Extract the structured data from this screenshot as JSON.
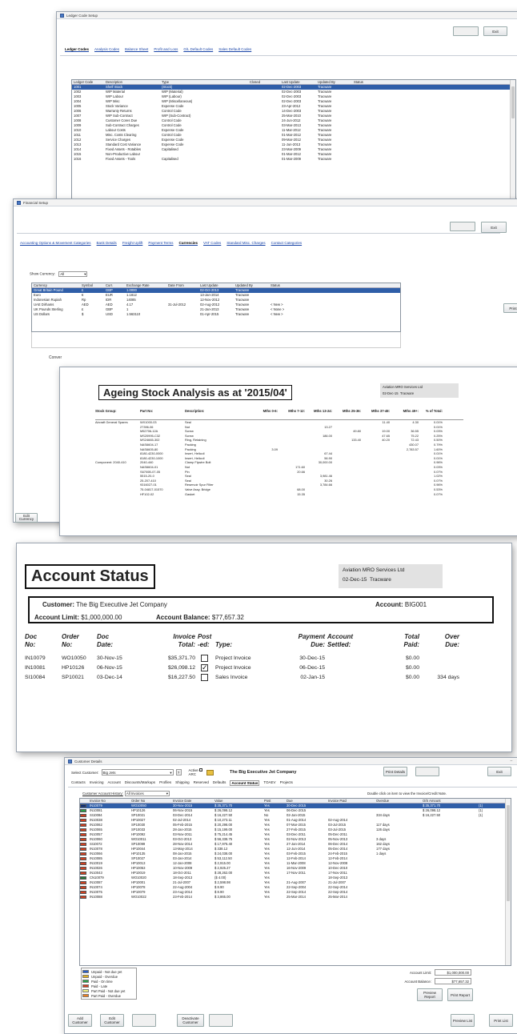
{
  "win1": {
    "title": "Ledger Code Setup",
    "btn_disabled": "",
    "btn_exit": "Exit",
    "tabs": [
      "Ledger Codes",
      "Analysis Codes",
      "Balance Sheet",
      "Profit and Loss",
      "G/L Default Codes",
      "Sales Default Codes"
    ],
    "columns": [
      "Ledger Code",
      "Description",
      "Type",
      "Closed",
      "Last Update",
      "Updated By",
      "Status"
    ],
    "rows": [
      [
        "1001",
        "Shelf Stock",
        "(Stock)",
        "",
        "02-Dec-2003",
        "Tracware",
        ""
      ],
      [
        "1002",
        "WIP Material",
        "WIP (Material)",
        "",
        "02-Dec-2003",
        "Tracware",
        ""
      ],
      [
        "1003",
        "WIP Labour",
        "WIP (Labour)",
        "",
        "02-Dec-2003",
        "Tracware",
        ""
      ],
      [
        "1004",
        "WIP Misc",
        "WIP (Miscellaneous)",
        "",
        "02-Dec-2003",
        "Tracware",
        ""
      ],
      [
        "1005",
        "Stock Variance",
        "Expense Code",
        "",
        "23-Apr-2012",
        "Tracware",
        ""
      ],
      [
        "1006",
        "Warranty Returns",
        "Control Code",
        "",
        "14-Dec-2003",
        "Tracware",
        ""
      ],
      [
        "1007",
        "WIP Sub-Contract",
        "WIP (Sub-Contract)",
        "",
        "25-Mar-2010",
        "Tracware",
        ""
      ],
      [
        "1008",
        "Customer Cores Due",
        "Control Code",
        "",
        "24-Jun-2012",
        "Tracware",
        ""
      ],
      [
        "1009",
        "Sub-Contract Charges",
        "Control Code",
        "",
        "03-Mar-2013",
        "Tracware",
        ""
      ],
      [
        "1010",
        "Labour Costs",
        "Expense Code",
        "",
        "11-Mar-2012",
        "Tracware",
        ""
      ],
      [
        "1011",
        "Misc. Costs Clearing",
        "Control Code",
        "",
        "01-Mar-2012",
        "Tracware",
        ""
      ],
      [
        "1012",
        "Service Charges",
        "Expense Code",
        "",
        "09-Mar-2012",
        "Tracware",
        ""
      ],
      [
        "1013",
        "Standard Cost Variance",
        "Expense Code",
        "",
        "11-Jun-2013",
        "Tracware",
        ""
      ],
      [
        "1014",
        "Fixed Assets - Rotables",
        "Capitalised",
        "",
        "23-Mar-2009",
        "Tracware",
        ""
      ],
      [
        "1015",
        "Non-Productive Labour",
        "",
        "",
        "01-Mar-2012",
        "Tracware",
        ""
      ],
      [
        "1016",
        "Fixed Assets - Tools",
        "Capitalised",
        "",
        "01-Mar-2009",
        "Tracware",
        ""
      ]
    ]
  },
  "win2": {
    "title": "Financial Setup",
    "btn_disabled": "",
    "btn_exit": "Exit",
    "tabs": [
      "Accounting Options & Movement Categories",
      "Bank Details",
      "Freight Uplift",
      "Payment Terms",
      "Currencies",
      "VAT Codes",
      "Standard Misc. Charges",
      "Contact Categories"
    ],
    "show_label": "Show Currency:",
    "show_value": "All",
    "columns": [
      "Currency",
      "Symbol",
      "Curr.",
      "Exchange Rate",
      "Date From",
      "Last Update",
      "Updated By",
      "Status"
    ],
    "rows": [
      [
        "Great Britain Pound",
        "£",
        "GBP",
        "1.0000",
        "",
        "02-Oct-2013",
        "Tracware",
        ""
      ],
      [
        "Euro",
        "€",
        "EUR",
        "1.1812",
        "",
        "13-Jan-2014",
        "Tracware",
        ""
      ],
      [
        "Indonesian Rupiah",
        "Rp",
        "IDR",
        "14085",
        "",
        "12-Nov-2012",
        "Tracware",
        ""
      ],
      [
        "UAE Dirhams",
        "AED",
        "AED",
        "4.17",
        "31-Jul-2012",
        "02-Aug-2012",
        "Tracware",
        "< New >"
      ],
      [
        "UK Pounds Sterling",
        "£",
        "GBP",
        "1",
        "",
        "21-Jan-2013",
        "Tracware",
        "< None >"
      ],
      [
        "US Dollars",
        "$",
        "USD",
        "1.563110",
        "",
        "01-Apr-2015",
        "Tracware",
        "< New >"
      ]
    ],
    "side_label": "Conver",
    "left_btn1": "Edit",
    "left_btn2": "Currency",
    "right_btn": "Print"
  },
  "win3": {
    "title": "Ageing Stock Analysis as at '2015/04'",
    "company": "Aviation MRO Services Ltd",
    "date": "02-Dec-15",
    "user": "Tracware",
    "columns": [
      "Stock Group:",
      "Part No:",
      "Description:",
      "Mths 0-6:",
      "Mths 7-12:",
      "Mths 13-24:",
      "Mths 25-36:",
      "Mths 37-48:",
      "Mths 49+:",
      "% of Total:"
    ],
    "rows": [
      [
        "Aircraft General Spares",
        "WX1000-03",
        "Seal",
        "",
        "",
        "",
        "",
        "11.40",
        "4.30",
        "0.01%"
      ],
      [
        "",
        "27396-06",
        "Nut",
        "",
        "",
        "13.27",
        "",
        "",
        "",
        "0.01%"
      ],
      [
        "",
        "M52706-12A",
        "Screw",
        "",
        "",
        "",
        "49.80",
        "19.00",
        "36.55",
        "0.03%"
      ],
      [
        "",
        "MS20995-C32",
        "Screw",
        "",
        "",
        "186.00",
        "",
        "47.65",
        "75.22",
        "0.25%"
      ],
      [
        "",
        "MS24665-302",
        "Ring, Retaining",
        "",
        "",
        "",
        "133.40",
        "40.20",
        "72.43",
        "0.50%"
      ],
      [
        "",
        "NAS6604-17",
        "Packing",
        "",
        "",
        "",
        "",
        "",
        "430.07",
        "0.79%"
      ],
      [
        "",
        "NAS6605-80",
        "Packing",
        "3.09",
        "",
        "",
        "",
        "",
        "2,783.57",
        "1.60%"
      ],
      [
        "",
        "8180-4230-0000",
        "Insert, Helicoil",
        "",
        "",
        "67.44",
        "",
        "",
        "",
        "0.01%"
      ],
      [
        "",
        "8180-4230-1000",
        "Insert, Helicoil",
        "",
        "",
        "56.90",
        "",
        "",
        "",
        "0.01%"
      ],
      [
        "Component: 2040-410",
        "2040-440",
        "Clamp Flywire Bolt",
        "",
        "",
        "30,000.00",
        "",
        "",
        "",
        "0.96%"
      ],
      [
        "",
        "NAS6604-01",
        "Nut",
        "",
        "171.60",
        "",
        "",
        "",
        "",
        "0.03%"
      ],
      [
        "",
        "S6700B-07-05",
        "Pin",
        "",
        "20.66",
        "",
        "",
        "",
        "",
        "0.07%"
      ],
      [
        "",
        "5515-20-0",
        "Seal",
        "",
        "",
        "3,981.46",
        "",
        "",
        "",
        "1.02%"
      ],
      [
        "",
        "25-207-410",
        "Seal",
        "",
        "",
        "30.26",
        "",
        "",
        "",
        "0.07%"
      ],
      [
        "",
        "9316027-01",
        "Reservoir Spur Filter",
        "",
        "",
        "3,784.66",
        "",
        "",
        "",
        "0.96%"
      ],
      [
        "",
        "75-04817-01570",
        "Valve Assy. Bridge",
        "",
        "68.00",
        "",
        "",
        "",
        "",
        "0.53%"
      ],
      [
        "",
        "HF102-02",
        "Gasket",
        "",
        "15.35",
        "",
        "",
        "",
        "",
        "0.07%"
      ]
    ]
  },
  "win4": {
    "title": "Account Status",
    "company": "Aviation MRO Services Ltd",
    "date": "02-Dec-15",
    "user": "Tracware",
    "customer_label": "Customer:",
    "customer": "The Big Executive Jet Company",
    "account_label": "Account:",
    "account": "BIG001",
    "limit_label": "Account Limit:",
    "limit": "$1,000,000.00",
    "balance_label": "Account Balance:",
    "balance": "$77,657.32",
    "h1": [
      "Doc",
      "Order",
      "Doc",
      "Invoice",
      "Post",
      "",
      "Payment",
      "Account",
      "Total",
      "Over"
    ],
    "h2": [
      "No:",
      "No:",
      "Date:",
      "Total:",
      "-ed:",
      "Type:",
      "Due:",
      "Settled:",
      "Paid:",
      "Due:"
    ],
    "rows": [
      {
        "doc": "IN10079",
        "order": "WO10050",
        "date": "30-Nov-15",
        "total": "$35,371.70",
        "posted": false,
        "type": "Project Invoice",
        "due": "30-Dec-15",
        "settled": "",
        "paid": "$0.00",
        "over": ""
      },
      {
        "doc": "IN10081",
        "order": "HP10126",
        "date": "06-Nov-15",
        "total": "$26,098.12",
        "posted": true,
        "type": "Project Invoice",
        "due": "06-Dec-15",
        "settled": "",
        "paid": "$0.00",
        "over": ""
      },
      {
        "doc": "SI10084",
        "order": "SP10021",
        "date": "03-Dec-14",
        "total": "$16,227.50",
        "posted": false,
        "type": "Sales Invoice",
        "due": "02-Jan-15",
        "settled": "",
        "paid": "$0.00",
        "over": "334 days"
      }
    ]
  },
  "win5": {
    "title": "Customer Details",
    "select_label": "Select Customer:",
    "select_value": "Big Jets",
    "active_label": "Active",
    "active2": "ARC",
    "company": "The Big Executive Jet Company",
    "btn_print": "Print Details",
    "btn_disabled": "",
    "btn_exit": "Exit",
    "tabs": [
      "Contacts",
      "Invoicing",
      "Account",
      "Discounts/Markups",
      "Profiles",
      "Shipping",
      "Reserved",
      "Defaults",
      "Account Status",
      "TOAEV",
      "Projects"
    ],
    "history_label": "Customer Account History:",
    "history_value": "All Invoices",
    "hint": "Double click on item to view the Invoice/Credit Note.",
    "columns": [
      "Invoice No",
      "Order No",
      "Invoice Date",
      "Value",
      "Post",
      "Due",
      "Invoice Paid",
      "Overdue",
      "O/S Amount"
    ],
    "rows": [
      [
        "#0a2a7a",
        "IN10079",
        "WO10050",
        "30-Nov-2015",
        "$ 35,371.70",
        "Yes",
        "30-Dec-2015",
        "",
        "",
        "$ 35,371.70",
        "(1)"
      ],
      [
        "#2aa04a",
        "IN10081",
        "HP10126",
        "06-Nov-2015",
        "$ 26,098.12",
        "Yes",
        "06-Dec-2015",
        "",
        "",
        "$ 26,098.12",
        "(1)"
      ],
      [
        "#d04020",
        "SI10084",
        "SP10021",
        "03-Dec-2014",
        "$ 16,227.50",
        "No",
        "02-Jan-2015",
        "",
        "334 days",
        "$ 16,227.50",
        "(1)"
      ],
      [
        "#d04020",
        "IN10038",
        "HP10027",
        "02-Jul-2014",
        "$ 10,273.11",
        "Yes",
        "01-Aug-2014",
        "02-Aug-2014",
        "",
        ""
      ],
      [
        "#d04020",
        "IN10062",
        "SP10030",
        "05-Feb-2015",
        "$ 20,298.00",
        "Yes",
        "07-Mar-2015",
        "03-Jul-2015",
        "117 days",
        ""
      ],
      [
        "#d04020",
        "IN10065",
        "SP10033",
        "28-Jan-2015",
        "$ 15,199.00",
        "Yes",
        "27-Feb-2015",
        "03-Jul-2015",
        "126 days",
        ""
      ],
      [
        "#d04020",
        "IN10057",
        "HP10092",
        "03-Nov-2011",
        "$ 75,214.45",
        "Yes",
        "03-Dec-2011",
        "05-Dec-2011",
        "",
        ""
      ],
      [
        "#d04020",
        "IN10060",
        "WO10011",
        "03-Oct-2013",
        "$ 56,338.75",
        "Yes",
        "02-Nov-2013",
        "05-Nov-2013",
        "3 days",
        ""
      ],
      [
        "#d04020",
        "SI10072",
        "SP10099",
        "28-Nov-2014",
        "$ 17,976.40",
        "Yes",
        "27-Jan-2014",
        "06-Dec-2014",
        "162 days",
        ""
      ],
      [
        "#d04020",
        "IN10078",
        "HP10044",
        "13-May-2014",
        "$ 338.12",
        "Yes",
        "12-Jun-2014",
        "05-Dec-2014",
        "177 days",
        ""
      ],
      [
        "#d04020",
        "IN10066",
        "HP10135",
        "08-Jan-2015",
        "$ 24,038.00",
        "Yes",
        "03-Feb-2015",
        "24-Feb-2015",
        "1 days",
        ""
      ],
      [
        "#d04020",
        "IN10085",
        "SP10027",
        "03-Jan-2014",
        "$ 53,112.50",
        "Yes",
        "12-Feb-2014",
        "12-Feb-2014",
        "",
        ""
      ],
      [
        "#d04020",
        "IN10019",
        "HP10013",
        "12-Jan-2008",
        "$ 2,915.00",
        "Yes",
        "11-Mar-2008",
        "12-Nov-2008",
        "",
        ""
      ],
      [
        "#d04020",
        "IN10026",
        "HP10053",
        "10-Nov-2009",
        "$ 2,925.27",
        "Yes",
        "16-Nov-2009",
        "10-Dec-2010",
        "",
        ""
      ],
      [
        "#d04020",
        "IN10043",
        "HP10019",
        "18-Oct-2011",
        "$ 28,262.00",
        "Yes",
        "17-Nov-2011",
        "17-Nov-2011",
        "",
        ""
      ],
      [
        "#2a7a3a",
        "CN10079",
        "WO10020",
        "18-Sep-2013",
        "($ 4.00)",
        "Yes",
        "",
        "18-Sep-2013",
        "",
        ""
      ],
      [
        "#d04020",
        "IN10087",
        "HP10001",
        "21-Jul-2007",
        "$ 2,598.98",
        "Yes",
        "21-Aug-2007",
        "21-Jul-2007",
        "",
        ""
      ],
      [
        "#d04020",
        "IN10074",
        "HP10078",
        "22-Aug-2004",
        "$ 8.90",
        "Yes",
        "22-Sep-2004",
        "22-Sep-2014",
        "",
        ""
      ],
      [
        "#d04020",
        "IN10075",
        "HP10079",
        "23-Aug-2014",
        "$ 8.90",
        "Yes",
        "22-Sep-2014",
        "22-Sep-2014",
        "",
        ""
      ],
      [
        "#d04020",
        "IN10088",
        "WO10022",
        "23-Feb-2014",
        "$ 3,865.00",
        "Yes",
        "25-Mar-2014",
        "25-Mar-2014",
        "",
        ""
      ]
    ],
    "legend": [
      {
        "color": "#2a60c8",
        "label": "Unpaid - Not due yet"
      },
      {
        "color": "#e0b020",
        "label": "Unpaid - Overdue"
      },
      {
        "color": "#2aa04a",
        "label": "Paid - On time"
      },
      {
        "color": "#d04020",
        "label": "Paid - Late"
      },
      {
        "color": "#f0f080",
        "label": "Part Paid - Not due yet"
      },
      {
        "color": "#f08020",
        "label": "Part Paid - Overdue"
      }
    ],
    "limit_label": "Account Limit:",
    "limit_value": "$1,000,000.00",
    "balance_label": "Account Balance:",
    "balance_value": "$77,657.32",
    "btn_preview_report": "Preview Report",
    "btn_print_report": "Print Report",
    "bottom_buttons": [
      "Add Customer",
      "Edit Customer",
      "",
      "Deactivate Customer",
      ""
    ],
    "btn_preview_list": "Preview List",
    "btn_print_list": "Print List"
  }
}
